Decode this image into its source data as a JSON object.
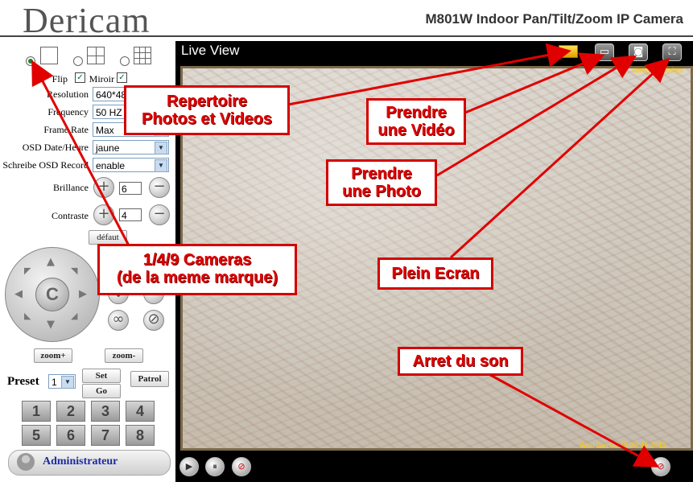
{
  "header": {
    "logo": "Dericam",
    "model": "M801W Indoor Pan/Tilt/Zoom  IP Camera"
  },
  "left_panel": {
    "layout_options": [
      {
        "label": "1",
        "selected": true
      },
      {
        "label": "4",
        "selected": false
      },
      {
        "label": "9",
        "selected": false
      }
    ],
    "flip_label": "Flip",
    "flip_checked": "✓",
    "mirror_label": "Miroir",
    "mirror_checked": "✓",
    "settings": [
      {
        "label": "Resolution",
        "value": "640*480"
      },
      {
        "label": "Frequency",
        "value": "50 HZ"
      },
      {
        "label": "Frame Rate",
        "value": "Max"
      },
      {
        "label": "OSD Date/Heure",
        "value": "jaune"
      },
      {
        "label": "Schreibe OSD Record",
        "value": "enable"
      }
    ],
    "brillance_label": "Brillance",
    "brillance_value": "6",
    "contraste_label": "Contraste",
    "contraste_value": "4",
    "default_button": "défaut",
    "joystick_center": "C",
    "zoom_in": "zoom+",
    "zoom_out": "zoom-",
    "preset_label": "Preset",
    "preset_value": "1",
    "set_button": "Set",
    "go_button": "Go",
    "patrol_button": "Patrol",
    "numpad": [
      "1",
      "2",
      "3",
      "4",
      "5",
      "6",
      "7",
      "8"
    ],
    "admin_label": "Administrateur"
  },
  "video": {
    "title": "Live View",
    "camera_label": "camera interieur",
    "timestamp": "Wed Jan 02 15:20:46 2013"
  },
  "annotations": {
    "repertoire": [
      "Repertoire",
      "Photos et Videos"
    ],
    "video": [
      "Prendre",
      "une Vidéo"
    ],
    "photo": [
      "Prendre",
      "une Photo"
    ],
    "cameras": [
      "1/4/9 Cameras",
      "(de la meme marque)"
    ],
    "plein": "Plein Ecran",
    "arret": "Arret du son"
  },
  "colors": {
    "annotation_red": "#e00000",
    "osd_yellow": "#ffcc00",
    "admin_blue": "#1a2aa0"
  }
}
